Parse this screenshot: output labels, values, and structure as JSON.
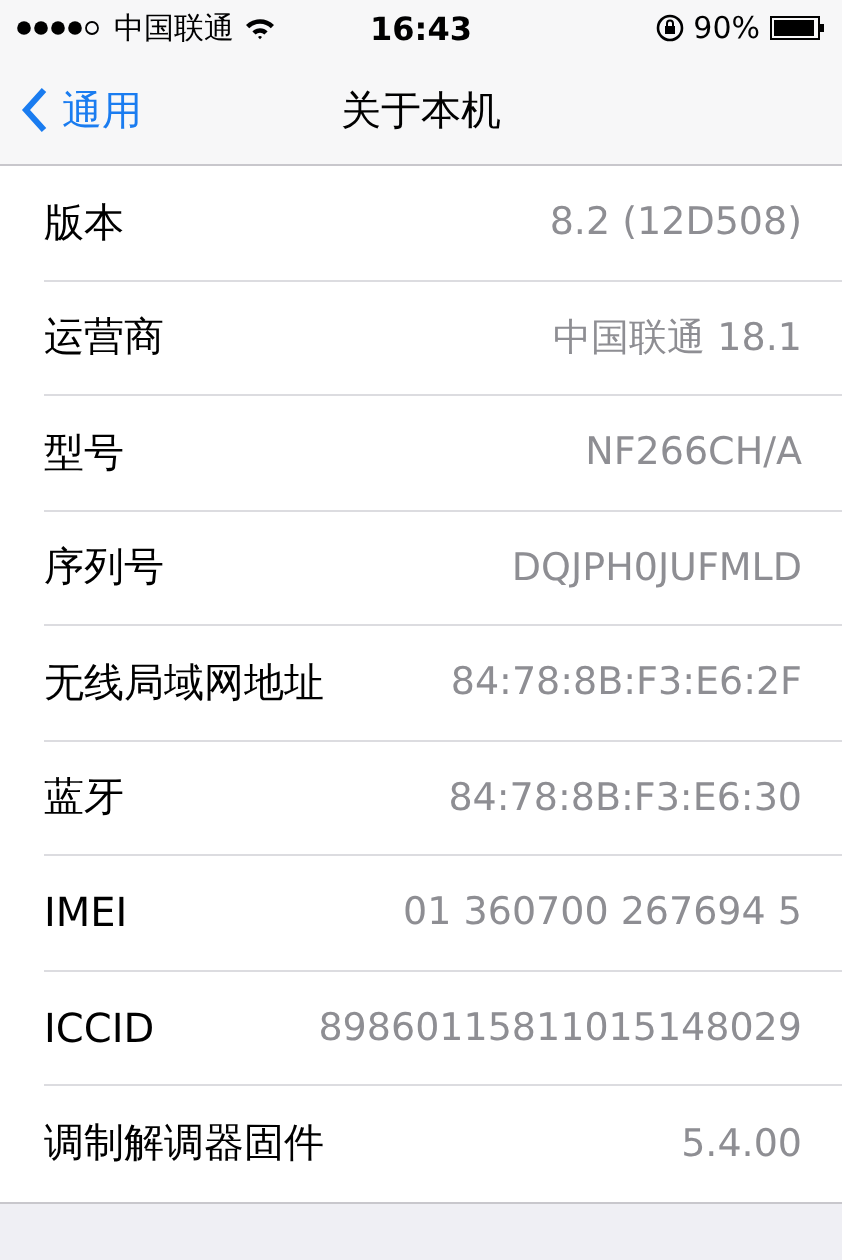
{
  "status_bar": {
    "carrier": "中国联通",
    "time": "16:43",
    "battery": "90%"
  },
  "nav": {
    "back": "通用",
    "title": "关于本机"
  },
  "rows": [
    {
      "label": "版本",
      "value": "8.2 (12D508)"
    },
    {
      "label": "运营商",
      "value": "中国联通 18.1"
    },
    {
      "label": "型号",
      "value": "NF266CH/A"
    },
    {
      "label": "序列号",
      "value": "DQJPH0JUFMLD"
    },
    {
      "label": "无线局域网地址",
      "value": "84:78:8B:F3:E6:2F"
    },
    {
      "label": "蓝牙",
      "value": "84:78:8B:F3:E6:30"
    },
    {
      "label": "IMEI",
      "value": "01 360700 267694 5"
    },
    {
      "label": "ICCID",
      "value": "89860115811015148029"
    },
    {
      "label": "调制解调器固件",
      "value": "5.4.00"
    }
  ]
}
